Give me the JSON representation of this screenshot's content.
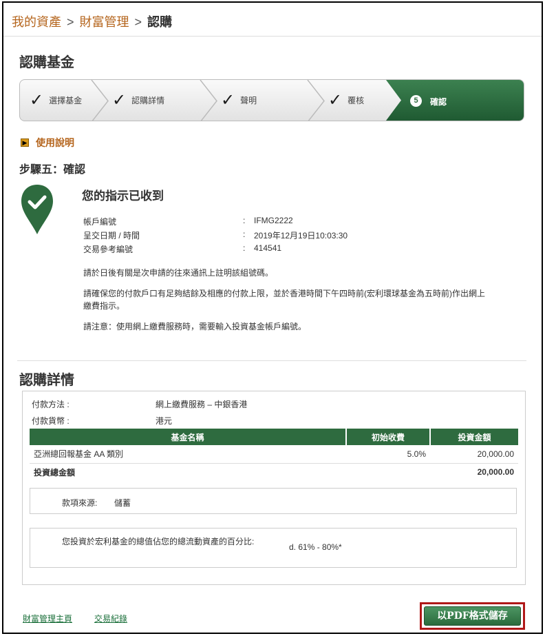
{
  "breadcrumb": {
    "item1": "我的資產",
    "sep": ">",
    "item2": "財富管理",
    "current": "認購"
  },
  "page_title": "認購基金",
  "steps": [
    {
      "label": "選擇基金",
      "status": "done"
    },
    {
      "label": "認購詳情",
      "status": "done"
    },
    {
      "label": "聲明",
      "status": "done"
    },
    {
      "label": "覆核",
      "status": "done"
    },
    {
      "number": "5",
      "label": "確認",
      "status": "active"
    }
  ],
  "check_glyph": "✓",
  "help_label": "使用說明",
  "step5_title": "步驟五：確認",
  "success_icon": "check-pin-icon",
  "received_title": "您的指示已收到",
  "info": [
    {
      "key": "帳戶編號",
      "colon": ":",
      "value": "IFMG2222"
    },
    {
      "key": "呈交日期 / 時間",
      "colon": ":",
      "value": "2019年12月19日10:03:30"
    },
    {
      "key": "交易參考編號",
      "colon": ":",
      "value": "414541"
    }
  ],
  "notes": [
    "請於日後有關是次申請的往來通訊上註明該組號碼。",
    "請確保您的付款戶口有足夠結餘及相應的付款上限，並於香港時間下午四時前(宏利環球基金為五時前)作出網上繳費指示。",
    "請注意：使用網上繳費服務時，需要輸入投資基金帳戶編號。"
  ],
  "details_title": "認購詳情",
  "payment_method": {
    "label": "付款方法 :",
    "value": "網上繳費服務 – 中銀香港"
  },
  "payment_currency": {
    "label": "付款貨幣 :",
    "value": "港元"
  },
  "table": {
    "headers": [
      "基金名稱",
      "初始收費",
      "投資金額"
    ],
    "rows": [
      {
        "name": "亞洲總回報基金 AA 類別",
        "fee": "5.0%",
        "amount": "20,000.00"
      }
    ],
    "total_label": "投資總金額",
    "total_amount": "20,000.00"
  },
  "source": {
    "label": "款項來源:",
    "value": "儲蓄"
  },
  "ratio": {
    "label": "您投資於宏利基金的總值佔您的總流動資產的百分比:",
    "value": "d. 61% - 80%*"
  },
  "footer": {
    "link1": "財富管理主頁",
    "link2": "交易紀錄",
    "pdf_button": "以PDF格式儲存"
  },
  "colors": {
    "brand_green": "#2e6b3f",
    "link_brown": "#b5651d",
    "highlight_red": "#b01818"
  }
}
